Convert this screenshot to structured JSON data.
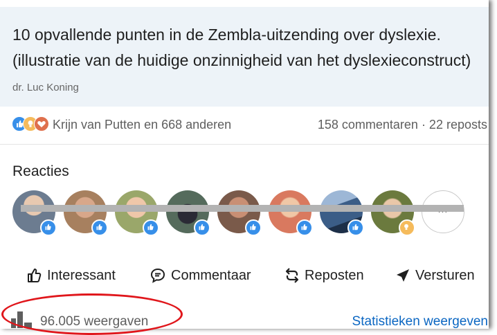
{
  "article": {
    "title": "10 opvallende punten in de Zembla-uitzending over dyslexie. (illustratie van de huidige onzinnigheid van het dyslexieconstruct)",
    "author": "dr. Luc Koning"
  },
  "social": {
    "reaction_icons": [
      "like-icon",
      "insight-icon",
      "love-icon"
    ],
    "reactors_text": "Krijn van Putten en 668 anderen",
    "counts_text": "158 commentaren · 22 reposts"
  },
  "reactions_section": {
    "label": "Reacties",
    "more_label": "...",
    "avatars": [
      {
        "badge": "like-icon",
        "tone": "#6c7c90"
      },
      {
        "badge": "like-icon",
        "tone": "#a7805f"
      },
      {
        "badge": "like-icon",
        "tone": "#9aa76a"
      },
      {
        "badge": "like-icon",
        "tone": "#556b5c"
      },
      {
        "badge": "like-icon",
        "tone": "#7a5a4a"
      },
      {
        "badge": "like-icon",
        "tone": "#d9795f"
      },
      {
        "badge": "like-icon",
        "tone": "#3b5d87"
      },
      {
        "badge": "insight-icon",
        "tone": "#6b7a3e"
      }
    ]
  },
  "actions": {
    "interesting": "Interessant",
    "comment": "Commentaar",
    "repost": "Reposten",
    "send": "Versturen"
  },
  "footer": {
    "views": "96.005 weergaven",
    "stats_link": "Statistieken weergeven"
  },
  "colors": {
    "link": "#0a66c2",
    "annotation_circle": "#e0161b",
    "like": "#378fe9",
    "insight": "#f5bb5c",
    "love": "#df704d"
  }
}
